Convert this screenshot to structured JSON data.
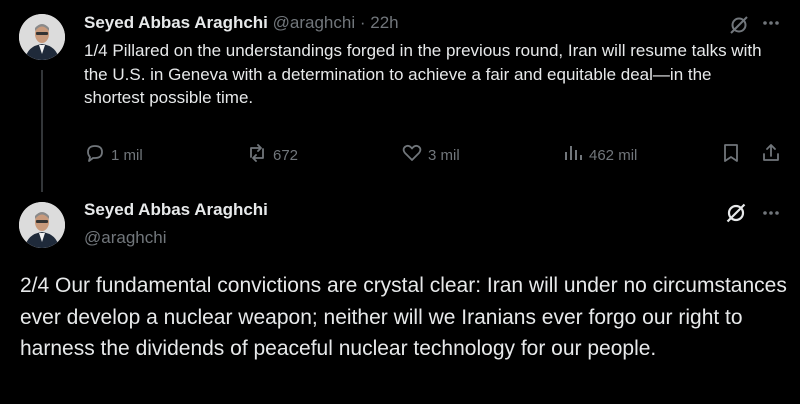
{
  "tweet1": {
    "author_name": "Seyed Abbas Araghchi",
    "handle": "@araghchi",
    "separator": "·",
    "time": "22h",
    "text": "1/4 Pillared on the understandings forged in the previous round, Iran will resume talks with the U.S. in Geneva with a determination to achieve a fair and equitable deal—in the shortest possible time.",
    "replies": "1 mil",
    "reposts": "672",
    "likes": "3 mil",
    "views": "462 mil"
  },
  "tweet2": {
    "author_name": "Seyed Abbas Araghchi",
    "handle": "@araghchi",
    "text": "2/4 Our fundamental convictions are crystal clear: Iran will under no circumstances ever develop a nuclear weapon; neither will we Iranians ever forgo our right to harness the dividends of peaceful nuclear technology for our people."
  },
  "icons": {
    "grok": "grok-icon",
    "more": "more-icon",
    "reply": "reply-icon",
    "repost": "repost-icon",
    "like": "like-icon",
    "views": "views-icon",
    "bookmark": "bookmark-icon",
    "share": "share-icon"
  },
  "colors": {
    "background": "#000000",
    "text": "#e7e9ea",
    "muted": "#71767b",
    "thread_line": "#333639"
  }
}
